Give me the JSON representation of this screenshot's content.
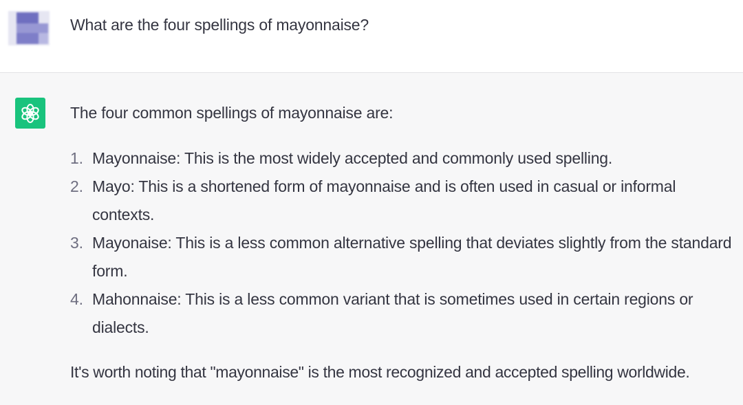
{
  "user_message": {
    "text": "What are the four spellings of mayonnaise?"
  },
  "assistant_message": {
    "icon": "openai-logo-icon",
    "intro": "The four common spellings of mayonnaise are:",
    "items": [
      {
        "number": "1.",
        "text": "Mayonnaise: This is the most widely accepted and commonly used spelling."
      },
      {
        "number": "2.",
        "text": "Mayo: This is a shortened form of mayonnaise and is often used in casual or informal contexts."
      },
      {
        "number": "3.",
        "text": "Mayonaise: This is a less common alternative spelling that deviates slightly from the standard form."
      },
      {
        "number": "4.",
        "text": "Mahonnaise: This is a less common variant that is sometimes used in certain regions or dialects."
      }
    ],
    "closing": "It's worth noting that \"mayonnaise\" is the most recognized and accepted spelling worldwide."
  },
  "colors": {
    "assistant_background": "#f7f7f8",
    "user_background": "#ffffff",
    "bot_icon_background": "#19c37d",
    "text": "#343541",
    "list_number": "#6e6e80"
  }
}
